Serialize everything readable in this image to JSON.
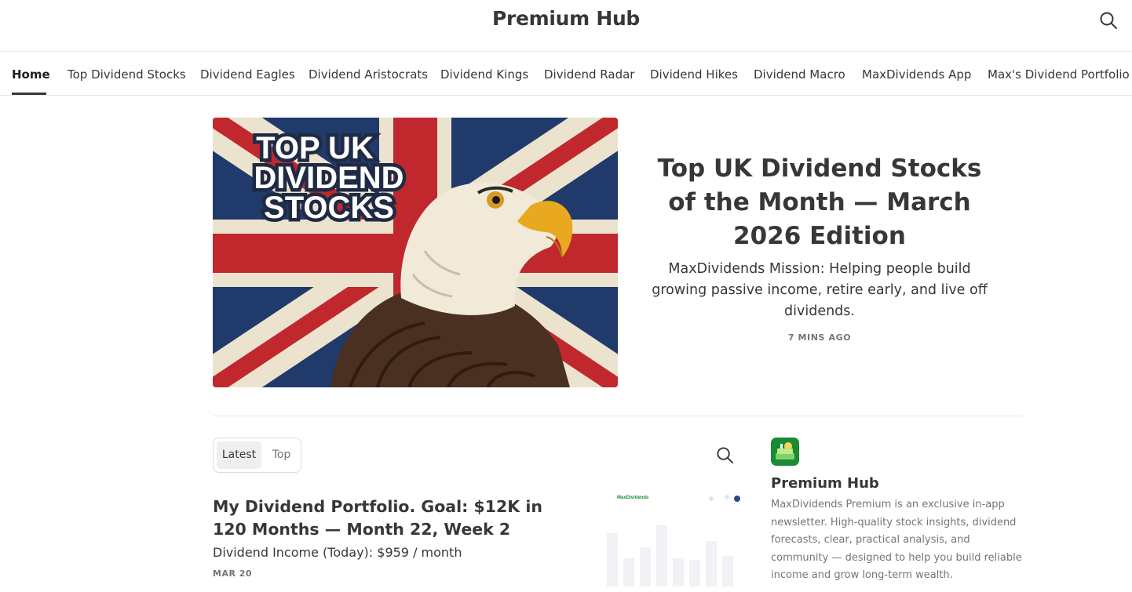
{
  "header": {
    "title": "Premium Hub",
    "search_icon": "search-icon"
  },
  "nav": {
    "items": [
      {
        "label": "Home",
        "active": true
      },
      {
        "label": "Top Dividend Stocks"
      },
      {
        "label": "Dividend Eagles"
      },
      {
        "label": "Dividend Aristocrats"
      },
      {
        "label": "Dividend Kings"
      },
      {
        "label": "Dividend Radar"
      },
      {
        "label": "Dividend Hikes"
      },
      {
        "label": "Dividend Macro"
      },
      {
        "label": "MaxDividends App"
      },
      {
        "label": "Max's Dividend Portfolio"
      }
    ]
  },
  "featured": {
    "image_text": [
      "TOP UK",
      "DIVIDEND",
      "STOCKS"
    ],
    "title": "Top UK Dividend Stocks of the Month — March 2026 Edition",
    "subtitle": "MaxDividends Mission: Helping people build growing passive income, retire early, and live off dividends.",
    "time": "7 MINS AGO"
  },
  "feed": {
    "tabs": [
      {
        "label": "Latest",
        "active": true
      },
      {
        "label": "Top"
      }
    ],
    "search_icon": "search-icon",
    "posts": [
      {
        "title": "My Dividend Portfolio. Goal: $12K in 120 Months — Month 22, Week 2",
        "subtitle": "Dividend Income (Today): $959 / month",
        "date": "MAR 20",
        "thumb_brand": "MaxDividends"
      }
    ]
  },
  "publication": {
    "name": "Premium Hub",
    "description": "MaxDividends Premium is an exclusive in-app newsletter. High-quality stock insights, dividend forecasts, clear, practical analysis, and community — designed to help you build reliable income and grow long-term wealth."
  },
  "colors": {
    "text": "#363737",
    "muted": "#757575",
    "border": "#e6e6e6",
    "brand_green": "#1a8a34",
    "flag_blue": "#1f3a6b",
    "flag_red": "#c0282e"
  }
}
